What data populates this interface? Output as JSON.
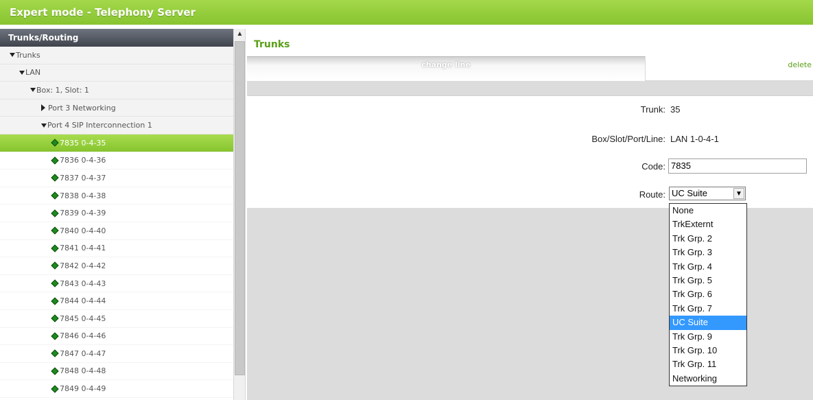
{
  "window": {
    "title": "Expert mode - Telephony Server"
  },
  "sidebar": {
    "header": "Trunks/Routing",
    "tree": [
      {
        "label": "Trunks",
        "icon": "triangle-down",
        "indent": 0
      },
      {
        "label": "LAN",
        "icon": "triangle-down",
        "indent": 1
      },
      {
        "label": "Box: 1, Slot: 1",
        "icon": "triangle-down",
        "indent": 2
      },
      {
        "label": "Port 3 Networking",
        "icon": "triangle-right",
        "indent": 3
      },
      {
        "label": "Port 4 SIP Interconnection 1",
        "icon": "triangle-down",
        "indent": 3
      }
    ],
    "lines": [
      {
        "label": "7835 0-4-35",
        "selected": true
      },
      {
        "label": "7836 0-4-36"
      },
      {
        "label": "7837 0-4-37"
      },
      {
        "label": "7838 0-4-38"
      },
      {
        "label": "7839 0-4-39"
      },
      {
        "label": "7840 0-4-40"
      },
      {
        "label": "7841 0-4-41"
      },
      {
        "label": "7842 0-4-42"
      },
      {
        "label": "7843 0-4-43"
      },
      {
        "label": "7844 0-4-44"
      },
      {
        "label": "7845 0-4-45"
      },
      {
        "label": "7846 0-4-46"
      },
      {
        "label": "7847 0-4-47"
      },
      {
        "label": "7848 0-4-48"
      },
      {
        "label": "7849 0-4-49"
      }
    ]
  },
  "main": {
    "title": "Trunks",
    "tabs": {
      "active": "change line",
      "delete": "delete"
    },
    "form": {
      "trunk_label": "Trunk:",
      "trunk_value": "35",
      "bsp_label": "Box/Slot/Port/Line:",
      "bsp_value": "LAN 1-0-4-1",
      "code_label": "Code:",
      "code_value": "7835",
      "route_label": "Route:",
      "route_value": "UC Suite"
    },
    "route_options": [
      "None",
      "TrkExternt",
      "Trk Grp. 2",
      "Trk Grp. 3",
      "Trk Grp. 4",
      "Trk Grp. 5",
      "Trk Grp. 6",
      "Trk Grp. 7",
      "UC Suite",
      "Trk Grp. 9",
      "Trk Grp. 10",
      "Trk Grp. 11",
      "Networking"
    ],
    "route_selected_index": 8
  },
  "colors": {
    "accent": "#88c431",
    "link": "#5aa016",
    "selection": "#3399ff"
  }
}
